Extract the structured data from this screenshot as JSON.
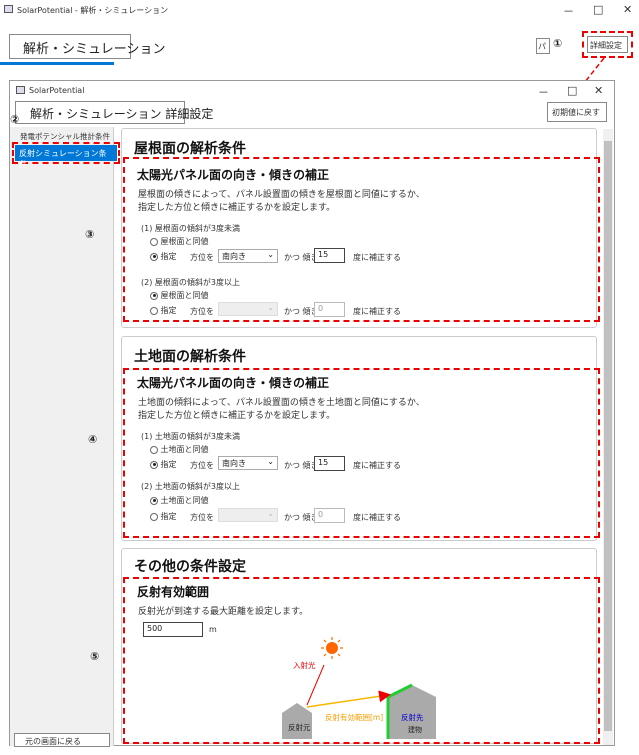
{
  "outer_window": {
    "title": "SolarPotential - 解析・シミュレーション",
    "header": "解析・シミュレーション",
    "partial_button": "パラ",
    "detail_button": "詳細設定",
    "controls": [
      "－",
      "□",
      "✕"
    ]
  },
  "inner_window": {
    "title": "SolarPotential",
    "header": "解析・シミュレーション 詳細設定",
    "reset_button": "初期値に戻す",
    "controls": [
      "－",
      "□",
      "✕"
    ]
  },
  "sidebar": {
    "items": [
      "発電ポテンシャル推計条件",
      "反射シミュレーション条件"
    ],
    "back_button": "元の画面に戻る"
  },
  "markers": [
    "①",
    "②",
    "③",
    "④",
    "⑤"
  ],
  "roof": {
    "section_title": "屋根面の解析条件",
    "sub_title": "太陽光パネル面の向き・傾きの補正",
    "desc1": "屋根面の傾きによって、パネル設置面の傾きを屋根面と同値にするか、",
    "desc2": "指定した方位と傾きに補正するかを設定します。",
    "cond1": "(1) 屋根面の傾斜が3度未満",
    "same1": "屋根面と同値",
    "cond2": "(2) 屋根面の傾斜が3度以上",
    "same2": "屋根面と同値",
    "specify": "指定",
    "azimuth_label": "方位を",
    "azimuth_value": "南向き",
    "tilt_label": "かつ 傾き",
    "tilt1": "15",
    "tilt2": "0",
    "correct": "度に補正する"
  },
  "land": {
    "section_title": "土地面の解析条件",
    "sub_title": "太陽光パネル面の向き・傾きの補正",
    "desc1": "土地面の傾斜によって、パネル設置面の傾きを土地面と同値にするか、",
    "desc2": "指定した方位と傾きに補正するかを設定します。",
    "cond1": "(1) 土地面の傾斜が3度未満",
    "same1": "土地面と同値",
    "cond2": "(2) 土地面の傾斜が3度以上",
    "same2": "土地面と同値",
    "specify": "指定",
    "azimuth_label": "方位を",
    "azimuth_value": "南向き",
    "tilt_label": "かつ 傾き",
    "tilt1": "15",
    "tilt2": "0",
    "correct": "度に補正する"
  },
  "other": {
    "section_title": "その他の条件設定",
    "sub_title": "反射有効範囲",
    "desc": "反射光が到達する最大距離を設定します。",
    "distance": "500",
    "unit": "m",
    "incident": "入射光",
    "range": "反射有効範囲[m]",
    "source": "反射元",
    "target": "反射先",
    "building": "建物"
  }
}
